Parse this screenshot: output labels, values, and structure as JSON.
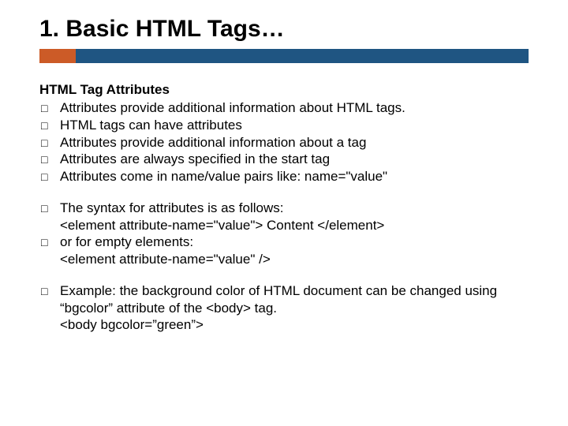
{
  "title": "1. Basic HTML Tags…",
  "subheading": "HTML Tag Attributes",
  "group1": [
    "Attributes provide additional information about HTML tags.",
    "HTML tags can have attributes",
    "Attributes provide additional information about a tag",
    "Attributes are always specified in the start tag",
    "Attributes come in name/value pairs like: name=\"value\""
  ],
  "group2": [
    {
      "line1": "The syntax for attributes is as follows:",
      "line2": "<element attribute-name=\"value\"> Content </element>"
    },
    {
      "line1": "or for empty elements:",
      "line2": "<element attribute-name=\"value\" />"
    }
  ],
  "group3": [
    {
      "line1": "Example: the background color of HTML document can be changed using “bgcolor” attribute of the <body> tag.",
      "line2": "<body bgcolor=”green”>"
    }
  ]
}
